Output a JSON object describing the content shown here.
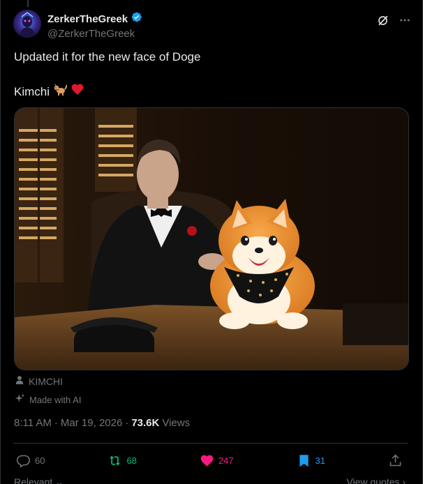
{
  "user": {
    "display_name": "ZerkerTheGreek",
    "handle": "@ZerkerTheGreek",
    "verified": true
  },
  "tweet": {
    "line1": "Updated it for the new face of Doge",
    "line2": "Kimchi",
    "line2_emoji": "dog-and-red-heart-emoji",
    "media_alt": "Elon Musk in a tuxedo with a red rose at a desk, resting his hand on a cartoon Shiba Inu dog wearing a black bandana"
  },
  "meta": {
    "tagged_person": "KIMCHI",
    "ai_label": "Made with AI"
  },
  "timestamp": {
    "time": "8:11 AM",
    "date": "Mar 19, 2026",
    "views_count": "73.6K",
    "views_label": "Views"
  },
  "actions": {
    "replies": "60",
    "reposts": "68",
    "likes": "247",
    "bookmarks": "31"
  },
  "footer": {
    "relevant": "Relevant",
    "view_quotes": "View quotes"
  },
  "colors": {
    "background": "#000000",
    "accent_blue": "#1d9bf0",
    "like_pink": "#f91880",
    "repost_green": "#00ba7c",
    "muted_text": "#71767b"
  },
  "icons": [
    "verified-badge-icon",
    "grok-icon",
    "more-icon",
    "person-icon",
    "sparkle-icon",
    "reply-icon",
    "repost-icon",
    "heart-icon",
    "bookmark-icon",
    "share-icon",
    "chevron-down-icon",
    "chevron-right-icon"
  ]
}
